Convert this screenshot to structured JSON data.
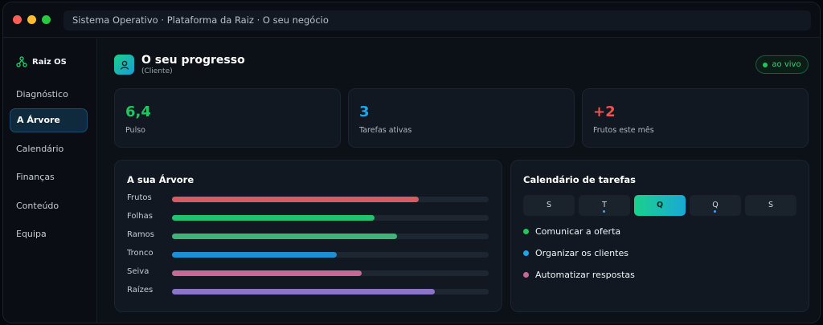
{
  "window": {
    "url": "Sistema Operativo · Plataforma da Raiz · O seu negócio"
  },
  "sidebar": {
    "brand": "Raiz OS",
    "brand_icon": "tree-nodes-icon",
    "items": [
      {
        "label": "Diagnóstico",
        "active": false
      },
      {
        "label": "A Árvore",
        "active": true
      },
      {
        "label": "Calendário",
        "active": false
      },
      {
        "label": "Finanças",
        "active": false
      },
      {
        "label": "Conteúdo",
        "active": false
      },
      {
        "label": "Equipa",
        "active": false
      }
    ]
  },
  "header": {
    "title": "O seu progresso",
    "subtitle": "(Cliente)",
    "icon": "user-icon",
    "badge": "ao vivo",
    "badge_color": "#22c55e"
  },
  "stats": [
    {
      "value": "6,4",
      "label": "Pulso",
      "color": "#22c55e"
    },
    {
      "value": "3",
      "label": "Tarefas ativas",
      "color": "#1fa6ea"
    },
    {
      "value": "+2",
      "label": "Frutos este mês",
      "color": "#ef5350"
    }
  ],
  "tree": {
    "title": "A sua Árvore",
    "rows": [
      {
        "label": "Frutos",
        "value": 0.78,
        "color": "#d35d62"
      },
      {
        "label": "Folhas",
        "value": 0.64,
        "color": "#22c36d"
      },
      {
        "label": "Ramos",
        "value": 0.71,
        "color": "#3db47a"
      },
      {
        "label": "Tronco",
        "value": 0.52,
        "color": "#1f8fd4"
      },
      {
        "label": "Seiva",
        "value": 0.6,
        "color": "#c46a97"
      },
      {
        "label": "Raízes",
        "value": 0.83,
        "color": "#8b74c9"
      }
    ]
  },
  "calendar": {
    "title": "Calendário de tarefas",
    "days": [
      {
        "label": "S",
        "active": false,
        "marked": false
      },
      {
        "label": "T",
        "active": false,
        "marked": true
      },
      {
        "label": "Q",
        "active": true,
        "marked": false
      },
      {
        "label": "Q",
        "active": false,
        "marked": true
      },
      {
        "label": "S",
        "active": false,
        "marked": false
      }
    ],
    "tasks": [
      {
        "label": "Comunicar a oferta",
        "color": "#22c55e"
      },
      {
        "label": "Organizar os clientes",
        "color": "#1fa6ea"
      },
      {
        "label": "Automatizar respostas",
        "color": "#c46a97"
      }
    ]
  }
}
